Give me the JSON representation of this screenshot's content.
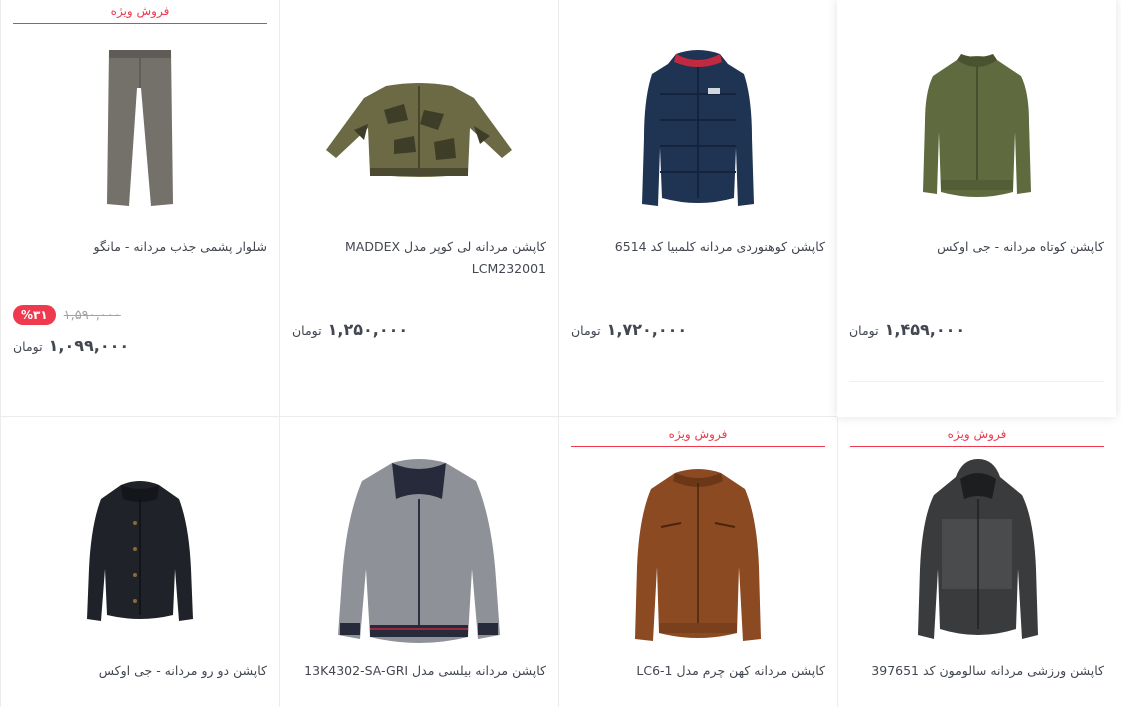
{
  "products": [
    {
      "title": "کاپشن کوتاه مردانه - جی اوکس",
      "price": "۱,۴۵۹,۰۰۰",
      "currency": "تومان",
      "special": ""
    },
    {
      "title": "کاپشن کوهنوردی مردانه کلمبیا کد 6514",
      "price": "۱,۷۲۰,۰۰۰",
      "currency": "تومان",
      "special": ""
    },
    {
      "title": "کاپشن مردانه لی کوپر مدل MADDEX LCM232001",
      "price": "۱,۲۵۰,۰۰۰",
      "currency": "تومان",
      "special": ""
    },
    {
      "title": "شلوار پشمی جذب مردانه - مانگو",
      "price": "۱,۰۹۹,۰۰۰",
      "old_price": "۱,۵۹۰,۰۰۰",
      "discount": "%۳۱",
      "currency": "تومان",
      "special": "فروش ویژه"
    },
    {
      "title": "کاپشن ورزشی مردانه سالومون کد 397651",
      "special": "فروش ویژه"
    },
    {
      "title": "کاپشن مردانه کهن چرم مدل LC6-1",
      "special": "فروش ویژه"
    },
    {
      "title": "کاپشن مردانه بیلسی مدل 13K4302-SA-GRI",
      "special": ""
    },
    {
      "title": "کاپشن دو رو مردانه - جی اوکس",
      "special": ""
    }
  ],
  "colors": {
    "accent": "#ef394e",
    "text": "#424750",
    "muted": "#a1a3a8"
  }
}
